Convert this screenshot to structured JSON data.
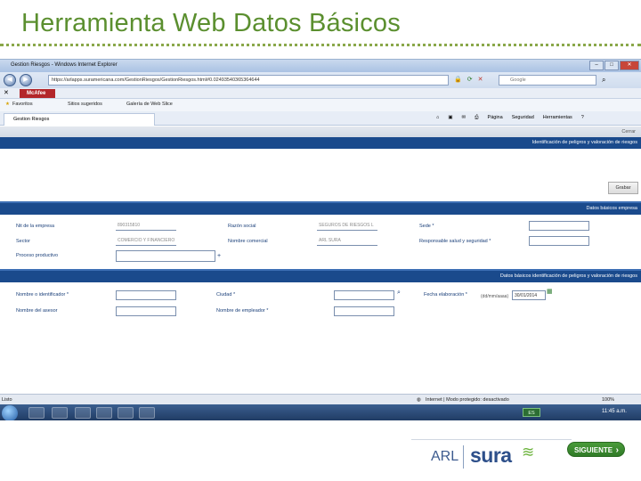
{
  "slide": {
    "title": "Herramienta Web Datos Básicos"
  },
  "browser": {
    "window_title": "Gestion Riesgos - Windows Internet Explorer",
    "url": "https://arlapps.suramericana.com/GestionRiesgos/GestionRiesgos.html#0.02493540365364644",
    "search_placeholder": "Google",
    "toolbar_brand": "McAfee",
    "favorites_label": "Favoritos",
    "suggested_sites_label": "Sitios sugeridos",
    "web_slice_label": "Galería de Web Slice",
    "tab_title": "Gestion Riesgos",
    "cmd_page": "Página",
    "cmd_security": "Seguridad",
    "cmd_tools": "Herramientas"
  },
  "page": {
    "close_label": "Cerrar",
    "header_identification": "Identificación de peligros y valoración de riesgos",
    "save_button": "Grabar",
    "section_company": "Datos básicos empresa",
    "section_identification": "Datos básicos identificación de peligros y valoración de riesgos",
    "company": {
      "nit_label": "Nit de la empresa",
      "nit_value": "890315810",
      "razon_label": "Razón social",
      "razon_value": "SEGUROS DE RIESGOS L",
      "sede_label": "Sede *",
      "sede_value": "",
      "sector_label": "Sector",
      "sector_value": "COMERCIO Y FINANCIERO",
      "comercial_label": "Nombre comercial",
      "comercial_value": "ARL SURA",
      "responsable_label": "Responsable salud y seguridad *",
      "responsable_value": "",
      "proceso_label": "Proceso productivo",
      "proceso_value": ""
    },
    "identification": {
      "nombre_id_label": "Nombre o identificador *",
      "ciudad_label": "Ciudad *",
      "fecha_label": "Fecha elaboración *",
      "fecha_format": "(dd/mm/aaaa)",
      "fecha_value": "30/01/2014",
      "asesor_label": "Nombre del asesor",
      "empleador_label": "Nombre de empleador *"
    }
  },
  "status": {
    "left": "Listo",
    "zone": "Internet | Modo protegido: desactivado",
    "zoom": "100%",
    "lang": "ES",
    "time": "11:45 a.m."
  },
  "footer": {
    "arl": "ARL",
    "sura": "sura",
    "next_button": "SIGUIENTE"
  },
  "colors": {
    "title_green": "#5b8f2f",
    "section_blue": "#1a4a8c",
    "brand_blue": "#2d4f8a",
    "brand_green": "#6bb33b"
  }
}
